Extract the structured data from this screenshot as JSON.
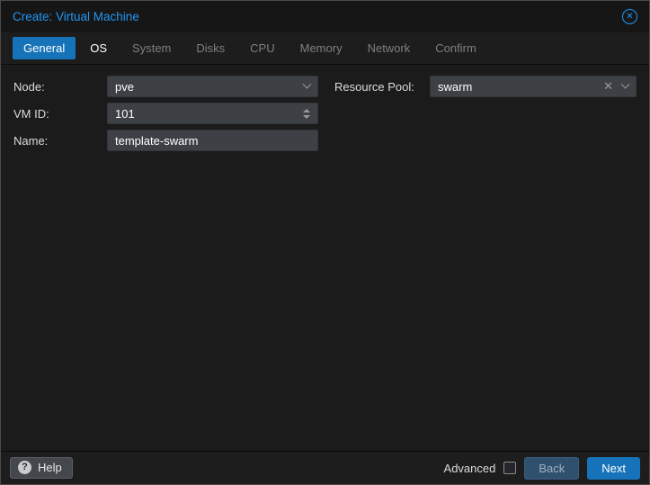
{
  "window": {
    "title": "Create: Virtual Machine"
  },
  "tabs": [
    {
      "label": "General",
      "state": "active"
    },
    {
      "label": "OS",
      "state": "enabled"
    },
    {
      "label": "System",
      "state": "disabled"
    },
    {
      "label": "Disks",
      "state": "disabled"
    },
    {
      "label": "CPU",
      "state": "disabled"
    },
    {
      "label": "Memory",
      "state": "disabled"
    },
    {
      "label": "Network",
      "state": "disabled"
    },
    {
      "label": "Confirm",
      "state": "disabled"
    }
  ],
  "form": {
    "node": {
      "label": "Node:",
      "value": "pve"
    },
    "vmid": {
      "label": "VM ID:",
      "value": "101"
    },
    "name": {
      "label": "Name:",
      "value": "template-swarm"
    },
    "resource_pool": {
      "label": "Resource Pool:",
      "value": "swarm"
    }
  },
  "footer": {
    "help": "Help",
    "advanced": "Advanced",
    "advanced_checked": false,
    "back": "Back",
    "next": "Next"
  },
  "icons": {
    "close": "close-icon",
    "clear": "×"
  },
  "colors": {
    "title_text": "#2196f3",
    "active_tab_bg": "#1673b9",
    "next_button_bg": "#1673b9",
    "field_bg": "#3d4045",
    "dialog_bg": "#1b1b1b"
  }
}
